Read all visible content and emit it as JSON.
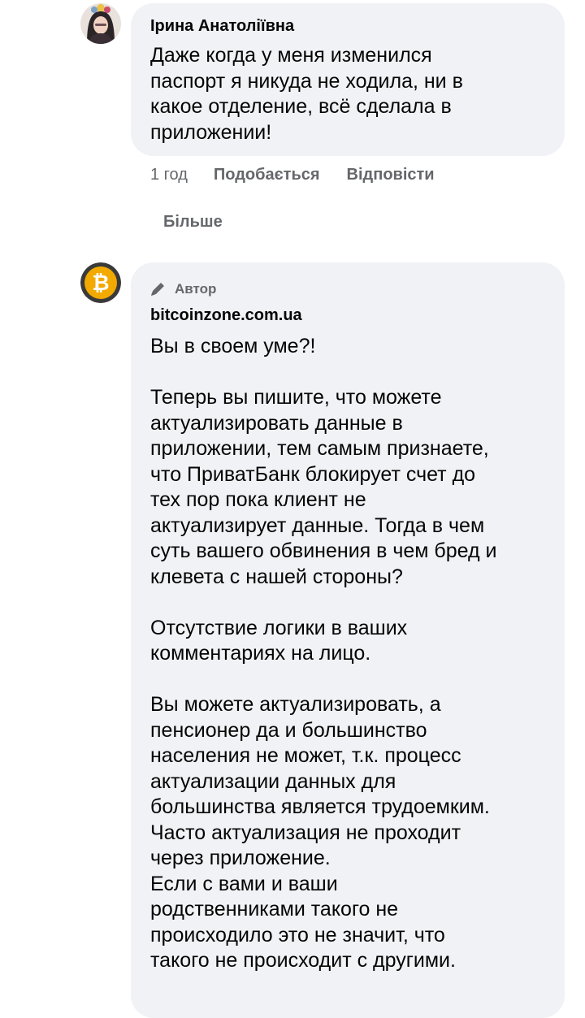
{
  "comments": [
    {
      "author": "Ірина Анатоліївна",
      "avatar_icon": "user-photo-avatar",
      "text": "Даже когда у меня изменился\nпаспорт я никуда не ходила, ни в\nкакое отделение, всё сделала в\nприложении!",
      "actions": {
        "time": "1 год",
        "like": "Подобається",
        "reply": "Відповісти"
      }
    },
    {
      "badge": "Автор",
      "badge_icon": "pencil-icon",
      "author": "bitcoinzone.com.ua",
      "avatar_icon": "bitcoin-icon",
      "text": "Вы в своем уме?!\n\nТеперь вы пишите, что можете\nактуализировать данные в\nприложении, тем самым признаете,\nчто ПриватБанк блокирует счет до\nтех пор пока клиент не\nактуализирует данные. Тогда в чем\nсуть вашего обвинения в чем бред и\nклевета с нашей стороны?\n\nОтсутствие логики в ваших\nкомментариях на лицо.\n\nВы можете актуализировать, а\nпенсионер да и большинство\nнаселения не может, т.к. процесс\nактуализации данных для\nбольшинства является трудоемким.\nЧасто актуализация не проходит\nчерез приложение.\nЕсли с вами и ваши\nродственниками такого не\nпроисходило это не значит, что\nтакого не происходит с другими."
    }
  ],
  "more_replies": "Більше",
  "colors": {
    "bubble": "#f0f2f5",
    "secondary_text": "#65676b",
    "bitcoin": "#f2a900"
  }
}
